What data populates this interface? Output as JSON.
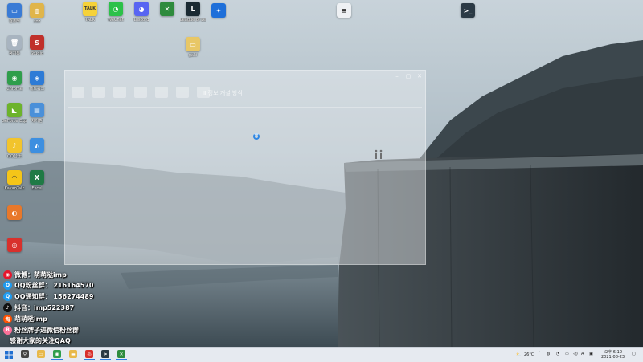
{
  "desktop": {
    "icons": [
      {
        "label": "컴퓨터",
        "icon": "computer-icon",
        "color": "#3a7bd5",
        "glyph": "▭"
      },
      {
        "label": "zoz",
        "icon": "user-folder-icon",
        "color": "#e0b54a",
        "glyph": "◍"
      },
      {
        "label": "휴지통",
        "icon": "recycle-bin-icon",
        "color": "#a8b4c0",
        "glyph": "🗑"
      },
      {
        "label": "Studio",
        "icon": "studio-icon",
        "color": "#c0302b",
        "glyph": "S"
      },
      {
        "label": "Chrome",
        "icon": "chrome-icon",
        "color": "#2f9e4b",
        "glyph": "◉"
      },
      {
        "label": "네트워크",
        "icon": "network-icon",
        "color": "#2e7bd6",
        "glyph": "◈"
      },
      {
        "label": "GeForce Experience",
        "icon": "nvidia-icon",
        "color": "#6cb32b",
        "glyph": "◣"
      },
      {
        "label": "제어판",
        "icon": "control-panel-icon",
        "color": "#4a90d9",
        "glyph": "▤"
      },
      {
        "label": "QQ音乐",
        "icon": "qq-music-icon",
        "color": "#f2c42c",
        "glyph": "♪"
      },
      {
        "label": "",
        "icon": "photos-icon",
        "color": "#3d8fe0",
        "glyph": "◭"
      },
      {
        "label": "KakaoTalk",
        "icon": "kakaotalk-icon",
        "color": "#f5c518",
        "glyph": "◠"
      },
      {
        "label": "Excel",
        "icon": "excel-icon",
        "color": "#1f7a45",
        "glyph": "X"
      },
      {
        "label": "",
        "icon": "app-orange-icon",
        "color": "#e8782a",
        "glyph": "◐"
      },
      {
        "label": "",
        "icon": "netease-music-icon",
        "color": "#d8302c",
        "glyph": "◎"
      },
      {
        "label": "TALK",
        "icon": "kakao-talk-top-icon",
        "color": "#f6d23a",
        "glyph": "TALK"
      },
      {
        "label": "WeChat",
        "icon": "wechat-icon",
        "color": "#2cc149",
        "glyph": "◔"
      },
      {
        "label": "Discord",
        "icon": "discord-icon",
        "color": "#5865f2",
        "glyph": "◕"
      },
      {
        "label": "",
        "icon": "xbox-icon",
        "color": "#2e8b3d",
        "glyph": "✕"
      },
      {
        "label": "League of Legends",
        "icon": "league-icon",
        "color": "#1a2a33",
        "glyph": "L"
      },
      {
        "label": "",
        "icon": "game-launcher-icon",
        "color": "#1e6fd9",
        "glyph": "✦"
      },
      {
        "label": "",
        "icon": "text-document-icon",
        "color": "#eef1f4",
        "glyph": "≡"
      },
      {
        "label": "gaki",
        "icon": "folder-icon",
        "color": "#e8c766",
        "glyph": "▭"
      },
      {
        "label": "",
        "icon": "terminal-icon",
        "color": "#2b3a45",
        "glyph": ">_"
      }
    ]
  },
  "overlay": {
    "lines": [
      {
        "text": "微博：萌萌哒imp",
        "badge_icon": "weibo-icon",
        "badge_color": "#e6162d",
        "badge_glyph": "◉"
      },
      {
        "text": "QQ粉丝群： 216164570",
        "badge_icon": "qq-icon",
        "badge_color": "#1e9bf0",
        "badge_glyph": "Q"
      },
      {
        "text": "QQ通知群： 156274489",
        "badge_icon": "qq-icon",
        "badge_color": "#1e9bf0",
        "badge_glyph": "Q"
      },
      {
        "text": "抖音：imp522387",
        "badge_icon": "douyin-icon",
        "badge_color": "#111111",
        "badge_glyph": "♪"
      },
      {
        "text": "萌萌哒imp",
        "badge_icon": "taobao-icon",
        "badge_color": "#ff5000",
        "badge_glyph": "淘"
      },
      {
        "text": "粉丝牌子进微信粉丝群",
        "badge_icon": "bilibili-icon",
        "badge_color": "#fb7299",
        "badge_glyph": "B"
      },
      {
        "text": "感谢大家的关注QAQ",
        "badge_icon": "",
        "badge_color": "",
        "badge_glyph": ""
      }
    ]
  },
  "window": {
    "ribbon_text": "Ⅱ 정보 개설 방식"
  },
  "taskbar": {
    "start_icon": "windows-start-icon",
    "apps": [
      {
        "icon": "search-icon",
        "glyph": "⚲",
        "color": "#444444",
        "open": false
      },
      {
        "icon": "file-explorer-icon",
        "glyph": "▭",
        "color": "#e8b94a",
        "open": false
      },
      {
        "icon": "chrome-taskbar-icon",
        "glyph": "◉",
        "color": "#2f9e4b",
        "open": true
      },
      {
        "icon": "folder-taskbar-icon",
        "glyph": "▬",
        "color": "#e8b94a",
        "open": false
      },
      {
        "icon": "netease-taskbar-icon",
        "glyph": "◎",
        "color": "#d8302c",
        "open": true
      },
      {
        "icon": "terminal-taskbar-icon",
        "glyph": ">",
        "color": "#2b3a45",
        "open": true
      },
      {
        "icon": "xbox-taskbar-icon",
        "glyph": "✕",
        "color": "#2e8b3d",
        "open": true
      }
    ],
    "tray": {
      "weather": "26°C",
      "input_mode": "A",
      "time": "오후 6:10",
      "date": "2021-08-23"
    }
  }
}
